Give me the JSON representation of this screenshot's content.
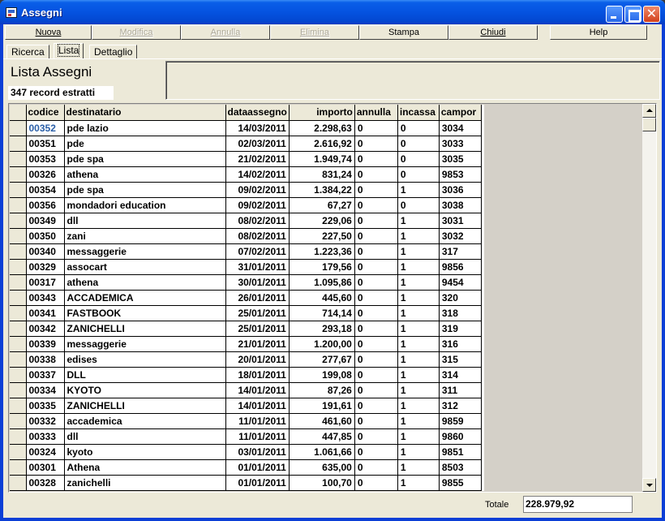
{
  "window": {
    "title": "Assegni"
  },
  "toolbar": [
    {
      "label": "Nuova",
      "enabled": true
    },
    {
      "label": "Modifica",
      "enabled": false
    },
    {
      "label": "Annulla",
      "enabled": false
    },
    {
      "label": "Elimina",
      "enabled": false
    },
    {
      "label": "Stampa",
      "enabled": true
    },
    {
      "label": "Chiudi",
      "enabled": true
    },
    {
      "label": "Help",
      "enabled": true
    }
  ],
  "tabs": [
    {
      "label": "Ricerca",
      "active": false
    },
    {
      "label": "Lista",
      "active": true
    },
    {
      "label": "Dettaglio",
      "active": false
    }
  ],
  "panel": {
    "title": "Lista Assegni",
    "record_count": "347 record estratti"
  },
  "table": {
    "columns": [
      "codice",
      "destinatario",
      "dataassegno",
      "importo",
      "annulla",
      "incassa",
      "campor"
    ],
    "rows": [
      [
        "00352",
        "pde lazio",
        "14/03/2011",
        "2.298,63",
        "0",
        "0",
        "3034"
      ],
      [
        "00351",
        "pde",
        "02/03/2011",
        "2.616,92",
        "0",
        "0",
        "3033"
      ],
      [
        "00353",
        "pde spa",
        "21/02/2011",
        "1.949,74",
        "0",
        "0",
        "3035"
      ],
      [
        "00326",
        "athena",
        "14/02/2011",
        "831,24",
        "0",
        "0",
        "9853"
      ],
      [
        "00354",
        "pde spa",
        "09/02/2011",
        "1.384,22",
        "0",
        "1",
        "3036"
      ],
      [
        "00356",
        "mondadori education",
        "09/02/2011",
        "67,27",
        "0",
        "0",
        "3038"
      ],
      [
        "00349",
        "dll",
        "08/02/2011",
        "229,06",
        "0",
        "1",
        "3031"
      ],
      [
        "00350",
        "zani",
        "08/02/2011",
        "227,50",
        "0",
        "1",
        "3032"
      ],
      [
        "00340",
        "messaggerie",
        "07/02/2011",
        "1.223,36",
        "0",
        "1",
        "317"
      ],
      [
        "00329",
        "assocart",
        "31/01/2011",
        "179,56",
        "0",
        "1",
        "9856"
      ],
      [
        "00317",
        "athena",
        "30/01/2011",
        "1.095,86",
        "0",
        "1",
        "9454"
      ],
      [
        "00343",
        "ACCADEMICA",
        "26/01/2011",
        "445,60",
        "0",
        "1",
        "320"
      ],
      [
        "00341",
        "FASTBOOK",
        "25/01/2011",
        "714,14",
        "0",
        "1",
        "318"
      ],
      [
        "00342",
        "ZANICHELLI",
        "25/01/2011",
        "293,18",
        "0",
        "1",
        "319"
      ],
      [
        "00339",
        "messaggerie",
        "21/01/2011",
        "1.200,00",
        "0",
        "1",
        "316"
      ],
      [
        "00338",
        "edises",
        "20/01/2011",
        "277,67",
        "0",
        "1",
        "315"
      ],
      [
        "00337",
        "DLL",
        "18/01/2011",
        "199,08",
        "0",
        "1",
        "314"
      ],
      [
        "00334",
        "KYOTO",
        "14/01/2011",
        "87,26",
        "0",
        "1",
        "311"
      ],
      [
        "00335",
        "ZANICHELLI",
        "14/01/2011",
        "191,61",
        "0",
        "1",
        "312"
      ],
      [
        "00332",
        "accademica",
        "11/01/2011",
        "461,60",
        "0",
        "1",
        "9859"
      ],
      [
        "00333",
        "dll",
        "11/01/2011",
        "447,85",
        "0",
        "1",
        "9860"
      ],
      [
        "00324",
        "kyoto",
        "03/01/2011",
        "1.061,66",
        "0",
        "1",
        "9851"
      ],
      [
        "00301",
        "Athena",
        "01/01/2011",
        "635,00",
        "0",
        "1",
        "8503"
      ],
      [
        "00328",
        "zanichelli",
        "01/01/2011",
        "100,70",
        "0",
        "1",
        "9855"
      ]
    ]
  },
  "footer": {
    "total_label": "Totale",
    "total_value": "228.979,92"
  },
  "icons": {
    "app": "app-icon",
    "minimize": "minimize-icon",
    "maximize": "maximize-icon",
    "close": "close-icon"
  },
  "colors": {
    "titlebar": "#0553e0",
    "face": "#ece9d8",
    "selected_code": "#2b5fa8"
  }
}
